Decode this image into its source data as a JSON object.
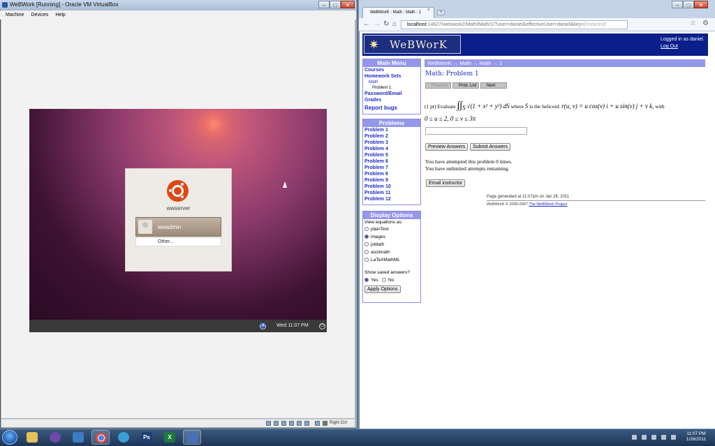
{
  "vbox": {
    "title": "WeBWork [Running] - Oracle VM VirtualBox",
    "menu": [
      "Machine",
      "Devices",
      "Help"
    ],
    "window_buttons": {
      "minimize": "–",
      "maximize": "□",
      "close": "✕"
    },
    "ubuntu": {
      "hostname": "wwserver",
      "user": "wwadmin",
      "other": "Other...",
      "time": "Wed 11:07 PM"
    },
    "status_right": "Right Ctrl"
  },
  "chrome": {
    "tab_title": "WeBWorK : Math : Math : 1",
    "tab_close": "×",
    "new_tab": "+",
    "url_host": "localhost",
    "url_rest": ":14627/webwork2/Math/Math/1/?user=daniel&effectiveUser=daniel&key=",
    "url_redacted": "[redacted]"
  },
  "webwork": {
    "logo": "WeBWorK",
    "logged_in": "Logged in as daniel.",
    "log_out": "Log Out",
    "main_menu": {
      "header": "Main Menu",
      "courses": "Courses",
      "homework_sets": "Homework Sets",
      "math": "Math",
      "problem": "Problem 1",
      "password_email": "Password/Email",
      "grades": "Grades",
      "report_bugs": "Report bugs"
    },
    "problems": {
      "header": "Problems",
      "items": [
        "Problem 1",
        "Problem 2",
        "Problem 3",
        "Problem 4",
        "Problem 5",
        "Problem 6",
        "Problem 7",
        "Problem 8",
        "Problem 9",
        "Problem 10",
        "Problem 11",
        "Problem 12"
      ]
    },
    "display_options": {
      "header": "Display Options",
      "view_label": "View equations as:",
      "modes": [
        "plainText",
        "images",
        "jsMath",
        "asciimath",
        "LaTeXMathML"
      ],
      "selected_mode": "images",
      "show_saved": "Show saved answers?",
      "yes": "Yes",
      "no": "No",
      "apply": "Apply Options"
    },
    "breadcrumb": "WeBWorK → Math → Math → 1",
    "problem_title": "Math: Problem 1",
    "nav": {
      "previous": "Previous",
      "prob_list": "Prob. List",
      "next": "Next"
    },
    "problem_text": {
      "points": "(1 pt) Evaluate",
      "integral": "∫∫",
      "subscript": "S",
      "integrand": "√(1 + x² + y²) dS",
      "where": "where",
      "s_var": "S",
      "helicoid": "is the helicoid:",
      "r_def": "r(u, v) = u cos(v) i + u sin(v) j + v k,",
      "with": "with",
      "bounds": "0 ≤ u ≤ 2, 0 ≤ v ≤ 3π"
    },
    "preview_button": "Preview Answers",
    "submit_button": "Submit Answers",
    "attempted": "You have attempted this problem 0 times.",
    "remaining": "You have unlimited attempts remaining.",
    "email_button": "Email instructor",
    "generated": "Page generated at 11:07pm on Jan 26, 2011",
    "footer_text": "WeBWorK © 2000-2007",
    "footer_link": "The WeBWorK Project"
  },
  "taskbar": {
    "time": "11:07 PM",
    "date": "1/26/2011"
  }
}
